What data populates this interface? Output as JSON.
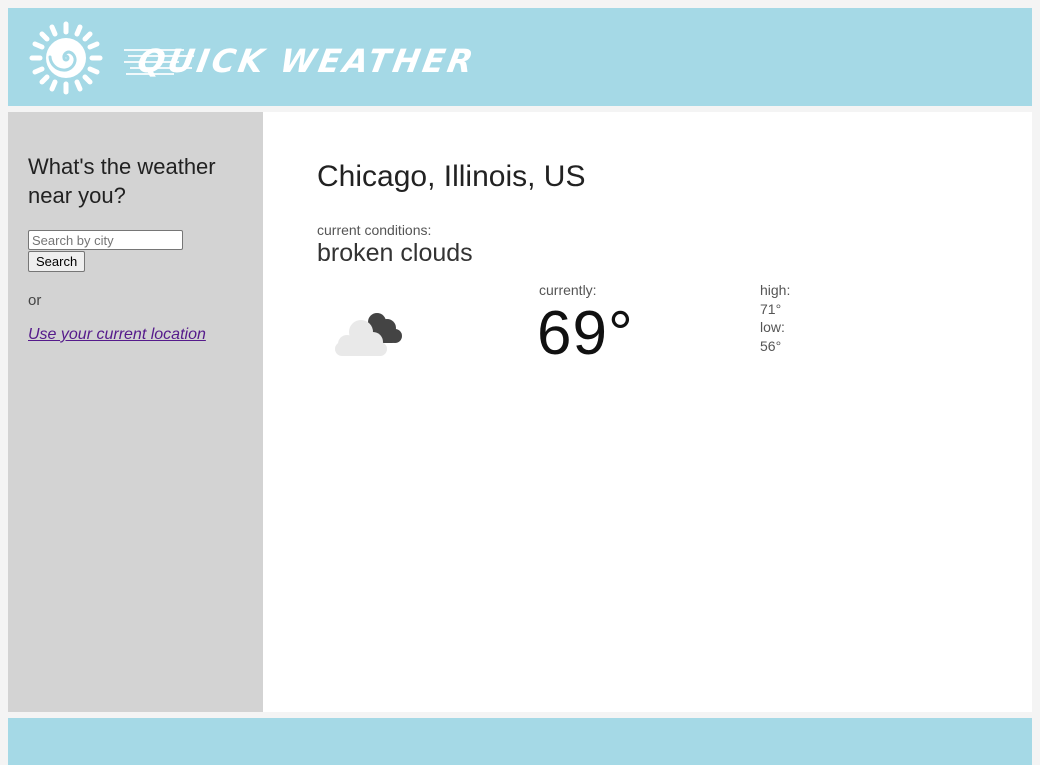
{
  "header": {
    "logo_text": "QUICK WEATHER",
    "sun_icon": "sun-spiral-icon",
    "background": "#a5d9e6"
  },
  "sidebar": {
    "prompt": "What's the weather near you?",
    "search_placeholder": "Search by city",
    "search_value": "",
    "search_button": "Search",
    "or_text": "or",
    "location_link": "Use your current location",
    "background": "#d3d3d3"
  },
  "main": {
    "city": "Chicago, Illinois, US",
    "conditions_label": "current conditions:",
    "conditions_value": "broken clouds",
    "weather_icon": "broken-clouds-icon",
    "currently_label": "currently:",
    "current_temp": "69°",
    "high_label": "high:",
    "high_value": "71°",
    "low_label": "low:",
    "low_value": "56°"
  },
  "footer": {
    "background": "#a5d9e6"
  }
}
